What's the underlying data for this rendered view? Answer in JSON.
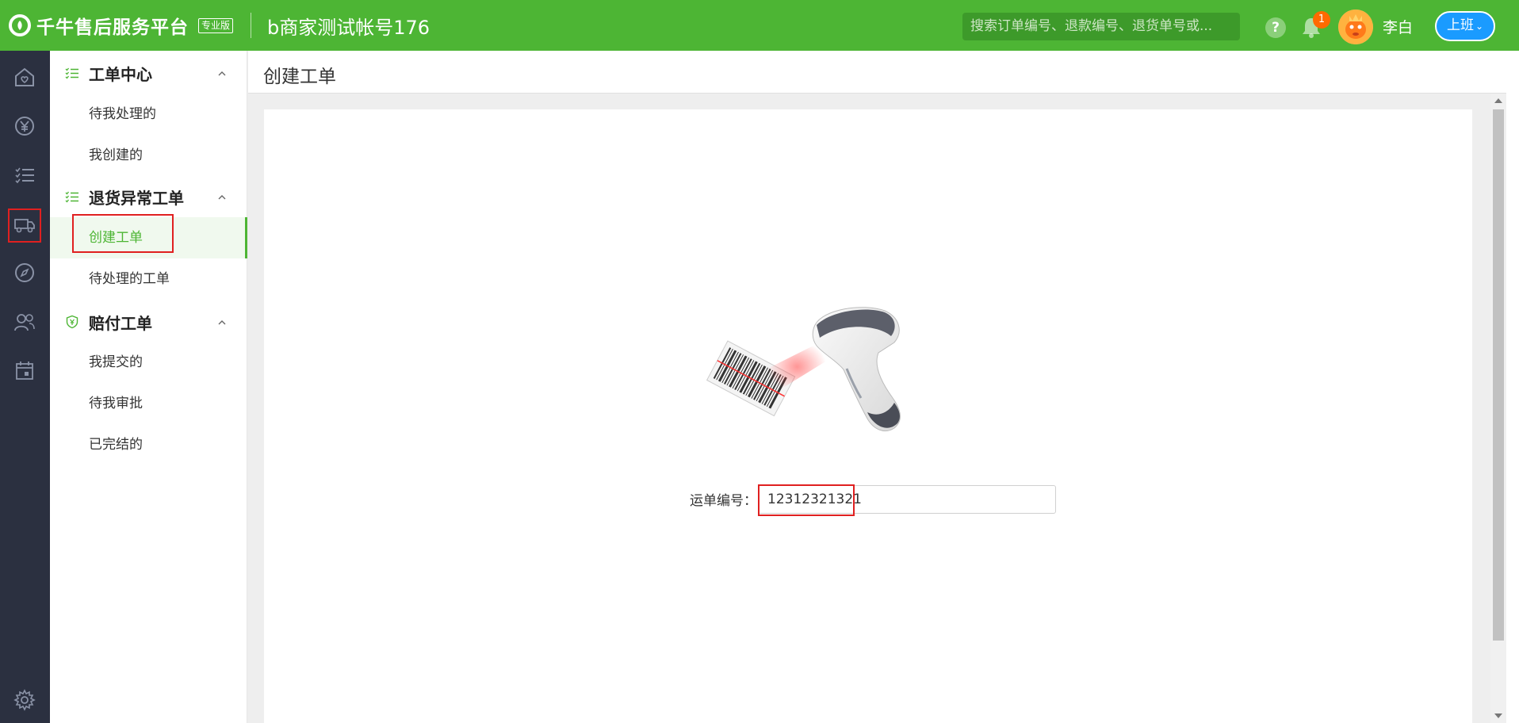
{
  "header": {
    "brand_title": "千牛售后服务平台",
    "brand_badge": "专业版",
    "account_name": "b商家测试帐号176",
    "search_placeholder": "搜索订单编号、退款编号、退货单号或...",
    "help_label": "?",
    "notification_count": "1",
    "user_name": "李白",
    "status_button": "上班"
  },
  "rail": {
    "icons": [
      "home-icon",
      "yen-icon",
      "task-list-icon",
      "truck-icon",
      "compass-icon",
      "users-icon",
      "calendar-icon",
      "settings-icon"
    ]
  },
  "sidebar": {
    "groups": [
      {
        "title": "工单中心",
        "items": [
          "待我处理的",
          "我创建的"
        ]
      },
      {
        "title": "退货异常工单",
        "items": [
          "创建工单",
          "待处理的工单"
        ]
      },
      {
        "title": "赔付工单",
        "items": [
          "我提交的",
          "待我审批",
          "已完结的"
        ]
      }
    ],
    "active_item": "创建工单"
  },
  "page": {
    "title": "创建工单"
  },
  "form": {
    "waybill_label": "运单编号：",
    "waybill_value": "12312321321"
  },
  "colors": {
    "brand_green": "#4db534",
    "rail_dark": "#2b3040",
    "accent_blue": "#1a9bff",
    "highlight_red": "#e02020",
    "badge_orange": "#ff6a00"
  }
}
